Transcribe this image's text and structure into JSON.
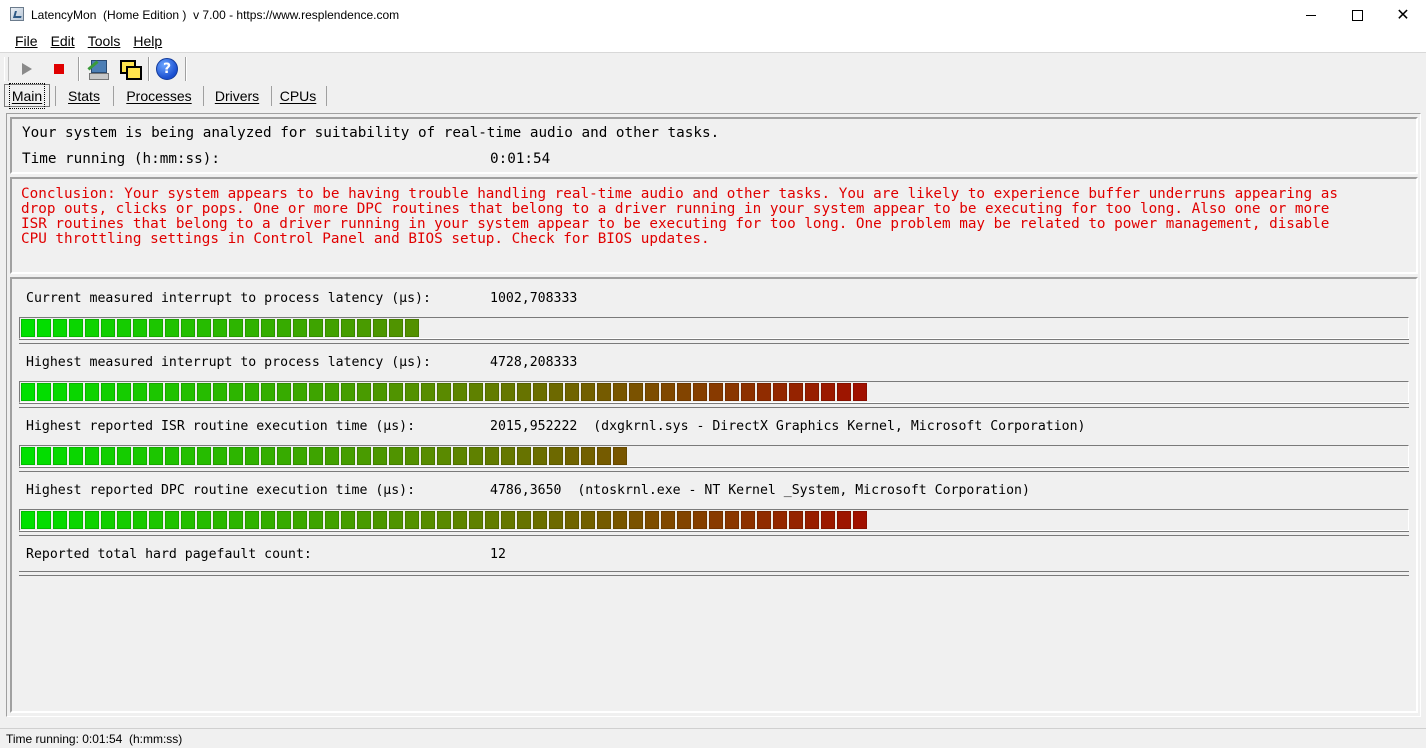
{
  "window": {
    "title": "LatencyMon  (Home Edition )  v 7.00 - https://www.resplendence.com",
    "minimize_icon": "minimize-icon",
    "maximize_icon": "maximize-icon",
    "close_icon": "close-icon"
  },
  "menu": {
    "items": [
      "File",
      "Edit",
      "Tools",
      "Help"
    ]
  },
  "toolbar": {
    "buttons": [
      "play-icon",
      "stop-icon",
      "tools-icon",
      "windows-icon",
      "help-icon"
    ]
  },
  "tabs": {
    "items": [
      "Main",
      "Stats",
      "Processes",
      "Drivers",
      "CPUs"
    ],
    "active": "Main"
  },
  "status": {
    "analyzing": "Your system is being analyzed for suitability of real-time audio and other tasks.",
    "time_label": "Time running (h:mm:ss):",
    "time_value": "0:01:54"
  },
  "conclusion": {
    "text": "Conclusion: Your system appears to be having trouble handling real-time audio and other tasks. You are likely to experience buffer underruns appearing as\ndrop outs, clicks or pops. One or more DPC routines that belong to a driver running in your system appear to be executing for too long. Also one or more\nISR routines that belong to a driver running in your system appear to be executing for too long. One problem may be related to power management, disable\nCPU throttling settings in Control Panel and BIOS setup. Check for BIOS updates.",
    "color": "#e00000"
  },
  "metrics": [
    {
      "label": "Current measured interrupt to process latency (µs):",
      "value": "1002,708333",
      "detail": "",
      "meter_level_segments": 25
    },
    {
      "label": "Highest measured interrupt to process latency (µs):",
      "value": "4728,208333",
      "detail": "",
      "meter_level_segments": 53
    },
    {
      "label": "Highest reported ISR routine execution time (µs):",
      "value": "2015,952222",
      "detail": "(dxgkrnl.sys - DirectX Graphics Kernel, Microsoft Corporation)",
      "meter_level_segments": 38
    },
    {
      "label": "Highest reported DPC routine execution time (µs):",
      "value": "4786,3650",
      "detail": "(ntoskrnl.exe - NT Kernel _System, Microsoft Corporation)",
      "meter_level_segments": 53
    },
    {
      "label": "Reported total hard pagefault count:",
      "value": "12",
      "detail": ""
    }
  ],
  "meter_colors": {
    "start": "#00e000",
    "mid": "#5a8a00",
    "end": "#a01000"
  },
  "statusbar": {
    "text": "Time running: 0:01:54  (h:mm:ss)"
  }
}
